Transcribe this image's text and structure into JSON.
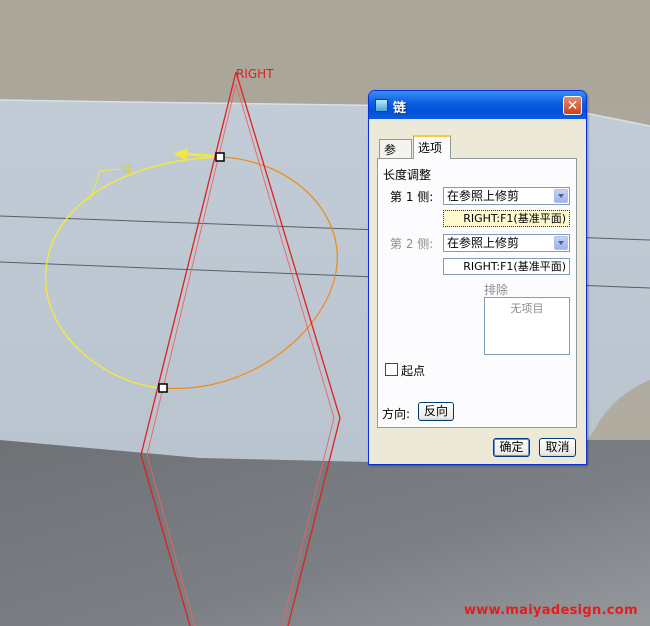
{
  "viewport": {
    "plane_label": "RIGHT",
    "sketch_tag": "链",
    "watermark": "www.maiyadesign.com"
  },
  "dialog": {
    "title": "链",
    "close_symbol": "✕",
    "tabs": [
      {
        "label": "参照",
        "active": false
      },
      {
        "label": "选项",
        "active": true
      }
    ],
    "section_title": "长度调整",
    "side1": {
      "label": "第 1 侧:",
      "value": "在参照上修剪",
      "reference": "RIGHT:F1(基准平面)"
    },
    "side2": {
      "label": "第 2 侧:",
      "value": "在参照上修剪",
      "reference": "RIGHT:F1(基准平面)"
    },
    "exclude": {
      "label": "排除",
      "placeholder": "无项目"
    },
    "start_point": {
      "label": "起点",
      "checked": false
    },
    "direction": {
      "label": "方向:",
      "button": "反向"
    },
    "ok_button": "确定",
    "cancel_button": "取消"
  },
  "colors": {
    "curve_red": "#e02020",
    "curve_orange": "#f08c1e",
    "selected_yellow": "#f5e83c",
    "background_top": "#a8a49a",
    "surface_blue": "#bcc8d3",
    "shadow_gray": "#7a7d80"
  }
}
